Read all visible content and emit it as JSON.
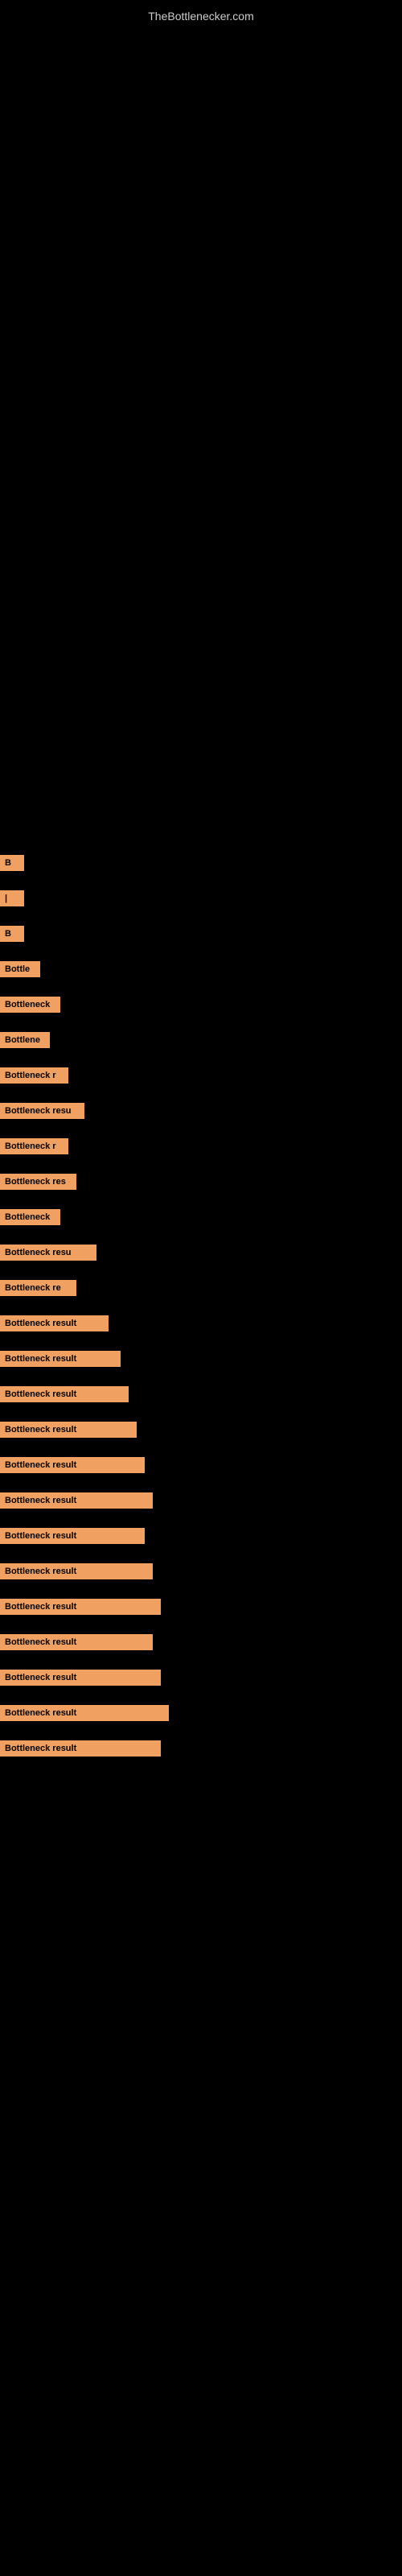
{
  "site": {
    "title": "TheBottlenecker.com"
  },
  "items": [
    {
      "id": 1,
      "label": "B",
      "width_class": "w-30"
    },
    {
      "id": 2,
      "label": "|",
      "width_class": "w-30"
    },
    {
      "id": 3,
      "label": "B",
      "width_class": "w-30"
    },
    {
      "id": 4,
      "label": "Bottle",
      "width_class": "w-50"
    },
    {
      "id": 5,
      "label": "Bottleneck",
      "width_class": "w-75"
    },
    {
      "id": 6,
      "label": "Bottlene",
      "width_class": "w-62"
    },
    {
      "id": 7,
      "label": "Bottleneck r",
      "width_class": "w-85"
    },
    {
      "id": 8,
      "label": "Bottleneck resu",
      "width_class": "w-105"
    },
    {
      "id": 9,
      "label": "Bottleneck r",
      "width_class": "w-85"
    },
    {
      "id": 10,
      "label": "Bottleneck res",
      "width_class": "w-95"
    },
    {
      "id": 11,
      "label": "Bottleneck",
      "width_class": "w-75"
    },
    {
      "id": 12,
      "label": "Bottleneck resu",
      "width_class": "w-120"
    },
    {
      "id": 13,
      "label": "Bottleneck re",
      "width_class": "w-95"
    },
    {
      "id": 14,
      "label": "Bottleneck result",
      "width_class": "w-135"
    },
    {
      "id": 15,
      "label": "Bottleneck result",
      "width_class": "w-150"
    },
    {
      "id": 16,
      "label": "Bottleneck result",
      "width_class": "w-160"
    },
    {
      "id": 17,
      "label": "Bottleneck result",
      "width_class": "w-170"
    },
    {
      "id": 18,
      "label": "Bottleneck result",
      "width_class": "w-180"
    },
    {
      "id": 19,
      "label": "Bottleneck result",
      "width_class": "w-190"
    },
    {
      "id": 20,
      "label": "Bottleneck result",
      "width_class": "w-180"
    },
    {
      "id": 21,
      "label": "Bottleneck result",
      "width_class": "w-190"
    },
    {
      "id": 22,
      "label": "Bottleneck result",
      "width_class": "w-200"
    },
    {
      "id": 23,
      "label": "Bottleneck result",
      "width_class": "w-190"
    },
    {
      "id": 24,
      "label": "Bottleneck result",
      "width_class": "w-200"
    },
    {
      "id": 25,
      "label": "Bottleneck result",
      "width_class": "w-210"
    },
    {
      "id": 26,
      "label": "Bottleneck result",
      "width_class": "w-200"
    }
  ]
}
